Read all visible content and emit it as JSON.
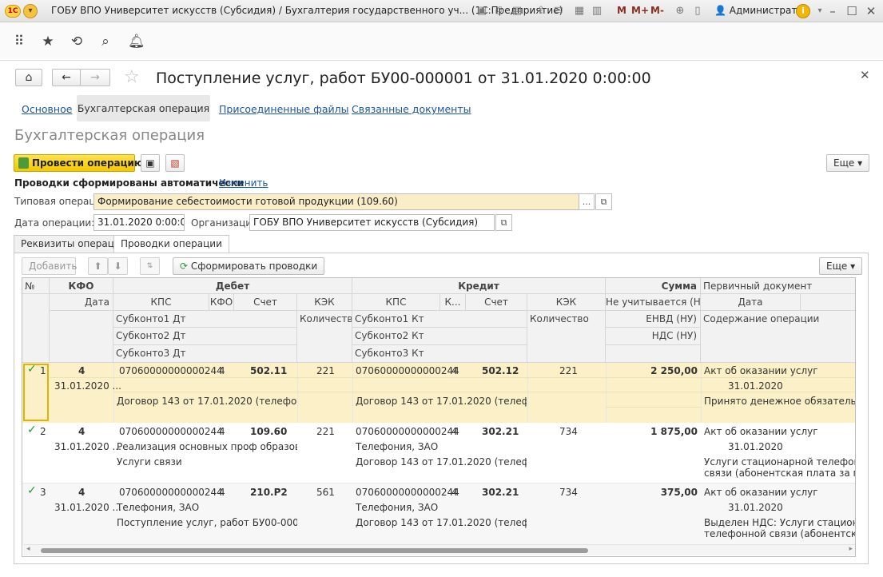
{
  "window": {
    "title": "ГОБУ ВПО Университет искусств (Субсидия) / Бухгалтерия государственного уч...  (1С:Предприятие)",
    "logo": "1С",
    "memory_buttons": [
      "M",
      "M+",
      "M-"
    ],
    "user": "Администратор"
  },
  "document": {
    "title": "Поступление услуг, работ БУ00-000001 от 31.01.2020 0:00:00",
    "tabs": [
      {
        "label": "Основное"
      },
      {
        "label": "Бухгалтерская операция"
      },
      {
        "label": "Присоединенные файлы"
      },
      {
        "label": "Связанные документы"
      }
    ],
    "section_title": "Бухгалтерская операция"
  },
  "actions": {
    "post_label": "Провести операцию",
    "more_label": "Еще"
  },
  "form": {
    "auto_text": "Проводки сформированы автоматически",
    "change_link": "Изменить",
    "typical_op_label": "Типовая операция:",
    "typical_op_value": "Формирование себестоимости готовой продукции (109.60)",
    "date_label": "Дата операции:",
    "date_value": "31.01.2020  0:00:00",
    "org_label": "Организация:",
    "org_value": "ГОБУ ВПО Университет искусств (Субсидия)",
    "ellipsis": "...",
    "inner_tabs": [
      {
        "label": "Реквизиты операции"
      },
      {
        "label": "Проводки операции"
      }
    ]
  },
  "grid_toolbar": {
    "add_label": "Добавить",
    "generate_label": "Сформировать проводки",
    "more_label": "Еще"
  },
  "grid": {
    "headers": {
      "num": "№",
      "kfo": "КФО",
      "debit": "Дебет",
      "credit": "Кредит",
      "sum": "Сумма",
      "primary_doc": "Первичный документ",
      "date": "Дата",
      "kps": "КПС",
      "kfo_small": "КФО",
      "account": "Счет",
      "kek": "КЭК",
      "k_short": "К...",
      "not_counted": "Не учитывается (НУ)",
      "date2": "Дата",
      "sub1_dt": "Субконто1 Дт",
      "sub2_dt": "Субконто2 Дт",
      "sub3_dt": "Субконто3 Дт",
      "qty": "Количество",
      "sub1_kt": "Субконто1 Кт",
      "sub2_kt": "Субконто2 Кт",
      "sub3_kt": "Субконто3 Кт",
      "qty2": "Количество",
      "envd": "ЕНВД (НУ)",
      "content": "Содержание операции",
      "vat": "НДС (НУ)"
    },
    "rows": [
      {
        "num": "1",
        "kfo": "4",
        "date": "31.01.2020 ...",
        "dt_kps": "07060000000000244",
        "dt_kfo": "4",
        "dt_account": "502.11",
        "dt_kek": "221",
        "dt_sub1": "",
        "dt_sub2": "Договор 143 от 17.01.2020 (телефонная с...",
        "kt_kps": "07060000000000244",
        "kt_kfo": "4",
        "kt_account": "502.12",
        "kt_kek": "221",
        "kt_sub1": "",
        "kt_sub2": "Договор 143 от 17.01.2020 (телефонна...",
        "sum": "2 250,00",
        "doc": "Акт об оказании услуг",
        "doc_date": "31.01.2020",
        "content": "Принято денежное обязательство",
        "content2": ""
      },
      {
        "num": "2",
        "kfo": "4",
        "date": "31.01.2020 ...",
        "dt_kps": "07060000000000244",
        "dt_kfo": "4",
        "dt_account": "109.60",
        "dt_kek": "221",
        "dt_sub1": "Реализация основных проф образовател...",
        "dt_sub2": "Услуги связи",
        "kt_kps": "07060000000000244",
        "kt_kfo": "4",
        "kt_account": "302.21",
        "kt_kek": "734",
        "kt_sub1": "Телефония, ЗАО",
        "kt_sub2": "Договор 143 от 17.01.2020 (телефонна...",
        "sum": "1 875,00",
        "doc": "Акт об оказании услуг",
        "doc_date": "31.01.2020",
        "content": "Услуги стационарной телефонной",
        "content2": "связи (абонентская плата за март ..."
      },
      {
        "num": "3",
        "kfo": "4",
        "date": "31.01.2020 ...",
        "dt_kps": "07060000000000244",
        "dt_kfo": "4",
        "dt_account": "210.Р2",
        "dt_kek": "561",
        "dt_sub1": "Телефония, ЗАО",
        "dt_sub2": "Поступление услуг, работ БУ00-000001 о...",
        "kt_kps": "07060000000000244",
        "kt_kfo": "4",
        "kt_account": "302.21",
        "kt_kek": "734",
        "kt_sub1": "Телефония, ЗАО",
        "kt_sub2": "Договор 143 от 17.01.2020 (телефонна...",
        "sum": "375,00",
        "doc": "Акт об оказании услуг",
        "doc_date": "31.01.2020",
        "content": "Выделен НДС: Услуги стационарной",
        "content2": "телефонной связи (абонентская ..."
      }
    ]
  }
}
